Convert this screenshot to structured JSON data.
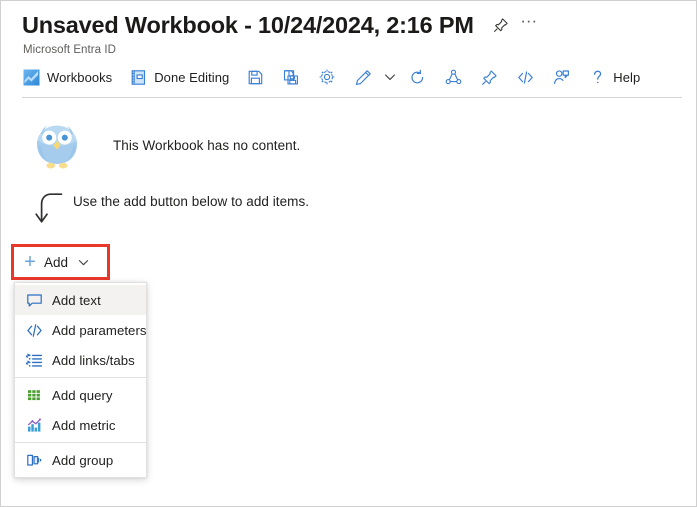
{
  "header": {
    "title": "Unsaved Workbook - 10/24/2024, 2:16 PM",
    "subtitle": "Microsoft Entra ID",
    "pin_icon": "pin-icon",
    "more_label": "···"
  },
  "toolbar": {
    "items": [
      {
        "label": "Workbooks",
        "icon": "workbooks-chart-icon"
      },
      {
        "label": "Done Editing",
        "icon": "done-editing-book-icon"
      },
      {
        "label": "",
        "icon": "save-icon"
      },
      {
        "label": "",
        "icon": "save-as-icon"
      },
      {
        "label": "",
        "icon": "settings-gear-icon"
      },
      {
        "label": "",
        "icon": "edit-pencil-icon"
      },
      {
        "label": "",
        "icon": "chevron-down-icon"
      },
      {
        "label": "",
        "icon": "refresh-icon"
      },
      {
        "label": "",
        "icon": "share-icon"
      },
      {
        "label": "",
        "icon": "pin-icon"
      },
      {
        "label": "",
        "icon": "code-brackets-icon"
      },
      {
        "label": "",
        "icon": "assign-user-icon"
      },
      {
        "label": "",
        "icon": "question-mark-icon"
      },
      {
        "label": "Help",
        "icon": ""
      }
    ],
    "help_label": "Help"
  },
  "content": {
    "empty_message": "This Workbook has no content.",
    "hint_message": "Use the add button below to add items.",
    "owl_icon": "owl-illustration",
    "hint_arrow_icon": "curved-down-arrow-icon"
  },
  "add_button": {
    "label": "Add",
    "plus_icon": "plus-icon",
    "caret_icon": "chevron-down-icon",
    "highlight_color": "#e8382b"
  },
  "add_menu": {
    "items": [
      {
        "label": "Add text",
        "icon": "text-comment-icon",
        "hovered": true,
        "sep_after": false
      },
      {
        "label": "Add parameters",
        "icon": "code-brackets-icon",
        "hovered": false,
        "sep_after": false
      },
      {
        "label": "Add links/tabs",
        "icon": "list-links-icon",
        "hovered": false,
        "sep_after": true
      },
      {
        "label": "Add query",
        "icon": "grid-query-icon",
        "hovered": false,
        "sep_after": false
      },
      {
        "label": "Add metric",
        "icon": "metric-chart-icon",
        "hovered": false,
        "sep_after": true
      },
      {
        "label": "Add group",
        "icon": "group-panels-icon",
        "hovered": false,
        "sep_after": false
      }
    ]
  },
  "colors": {
    "azure_blue": "#0078d4",
    "icon_blue": "#3b7fd4",
    "green": "#3f9c35",
    "red_highlight": "#e8382b",
    "owl_body": "#a6cced",
    "owl_beak": "#f5d776"
  }
}
